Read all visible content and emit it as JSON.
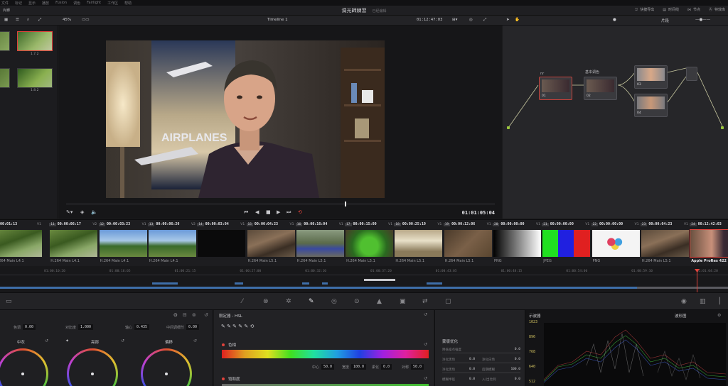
{
  "menu": [
    "文件",
    "标记",
    "显示",
    "播放",
    "Fusion",
    "调色",
    "Fairlight",
    "工作区",
    "帮助"
  ],
  "title": {
    "project": "调光師練習",
    "status": "已经编辑"
  },
  "top_right_tools": [
    {
      "label": "快捷导出",
      "icon": "export-icon"
    },
    {
      "label": "时间线",
      "icon": "timeline-icon"
    },
    {
      "label": "节点",
      "icon": "nodes-icon"
    },
    {
      "label": "特效库",
      "icon": "effects-icon"
    }
  ],
  "gallery_album": "片廊",
  "viewer_toolbar": {
    "zoom": "45%",
    "timeline_name": "Timeline 1",
    "source_timecode": "01:12:47:03",
    "node_mode": "片段"
  },
  "gallery_stills": [
    {
      "label": "1.7.2",
      "selected": true
    },
    {
      "label": "1.8.2",
      "selected": false
    }
  ],
  "viewer": {
    "current_timecode": "01:01:05:04",
    "poster_text": "AIRPLANES"
  },
  "nodes": [
    {
      "id": "01",
      "label": "nr",
      "active": true
    },
    {
      "id": "02",
      "label": "基本调色",
      "active": false
    },
    {
      "id": "03",
      "label": "",
      "active": false
    },
    {
      "id": "04",
      "label": "",
      "active": false
    }
  ],
  "clips": [
    {
      "num": "",
      "timecode": "00:00:01:13",
      "track": "V1",
      "codec": "H.264 Main L4.1",
      "thumb": "trees"
    },
    {
      "num": "11",
      "timecode": "00:00:06:17",
      "track": "V2",
      "codec": "H.264 Main L4.1",
      "thumb": "trees"
    },
    {
      "num": "12",
      "timecode": "00:00:03:23",
      "track": "V1",
      "codec": "H.264 Main L4.1",
      "thumb": "sky"
    },
    {
      "num": "13",
      "timecode": "00:00:06:20",
      "track": "V2",
      "codec": "H.264 Main L4.1",
      "thumb": "sky"
    },
    {
      "num": "14",
      "timecode": "00:00:03:04",
      "track": "V1",
      "codec": "",
      "thumb": "black"
    },
    {
      "num": "15",
      "timecode": "00:00:04:23",
      "track": "V1",
      "codec": "H.264 Main L5.1",
      "thumb": "room"
    },
    {
      "num": "16",
      "timecode": "00:00:16:04",
      "track": "V1",
      "codec": "H.264 Main L5.1",
      "thumb": "moto"
    },
    {
      "num": "17",
      "timecode": "00:00:15:00",
      "track": "V1",
      "codec": "H.264 Main L5.1",
      "thumb": "green"
    },
    {
      "num": "18",
      "timecode": "00:00:25:19",
      "track": "V1",
      "codec": "H.264 Main L5.1",
      "thumb": "cafe"
    },
    {
      "num": "19",
      "timecode": "00:00:12:06",
      "track": "V1",
      "codec": "H.264 Main L5.1",
      "thumb": "wood"
    },
    {
      "num": "20",
      "timecode": "00:00:00:00",
      "track": "V1",
      "codec": "PNG",
      "thumb": "gradient"
    },
    {
      "num": "21",
      "timecode": "00:00:00:00",
      "track": "V1",
      "codec": "JPEG",
      "thumb": "rgb"
    },
    {
      "num": "22",
      "timecode": "00:00:00:00",
      "track": "V1",
      "codec": "PNG",
      "thumb": "circles"
    },
    {
      "num": "23",
      "timecode": "00:00:04:23",
      "track": "V1",
      "codec": "H.264 Main L5.1",
      "thumb": "room"
    },
    {
      "num": "24",
      "timecode": "00:12:42:03",
      "track": "V1",
      "codec": "Apple ProRes 422",
      "thumb": "man",
      "current": true
    }
  ],
  "ruler_ticks": [
    "01:00:10:20",
    "01:00:16:05",
    "01:00:21:15",
    "01:00:27:00",
    "01:00:32:10",
    "01:00:37:20",
    "01:00:43:05",
    "01:00:48:15",
    "01:00:54:00",
    "01:00:59:10",
    "01:01:04:20"
  ],
  "wheels_params": [
    {
      "label": "色调",
      "value": "0.00"
    },
    {
      "label": "对比度",
      "value": "1.000"
    },
    {
      "label": "轴心",
      "value": "0.435"
    },
    {
      "label": "中间调细节",
      "value": "0.00"
    }
  ],
  "wheels": [
    {
      "title": "中灰"
    },
    {
      "title": "亮部"
    },
    {
      "title": "偏移"
    }
  ],
  "hsl": {
    "title": "限定器 - HSL",
    "hue_label": "色相",
    "sat_label": "饱和度",
    "fields": [
      {
        "label": "中心",
        "value": "50.0"
      },
      {
        "label": "宽度",
        "value": "100.0"
      },
      {
        "label": "柔化",
        "value": "0.0"
      },
      {
        "label": "对称",
        "value": "50.0"
      }
    ]
  },
  "matte": {
    "title": "蒙版优化",
    "rows": [
      {
        "label": "降低噪点强度",
        "value": "0.0"
      },
      {
        "label": "净化黑场",
        "value": "0.0",
        "label2": "净化白场",
        "value2": "0.0"
      },
      {
        "label": "净化黑场",
        "value": "0.0",
        "label2": "后期模糊",
        "value2": "100.0"
      },
      {
        "label": "模糊半径",
        "value": "0.0",
        "label2": "入/出比例",
        "value2": "0.0"
      }
    ]
  },
  "scope": {
    "title": "示波器",
    "mode": "波形图",
    "ticks": [
      "1023",
      "896",
      "768",
      "640",
      "512"
    ]
  },
  "colors": {
    "accent": "#e0423b",
    "pin": "#9bc53d",
    "track": "#3e6ea8"
  }
}
